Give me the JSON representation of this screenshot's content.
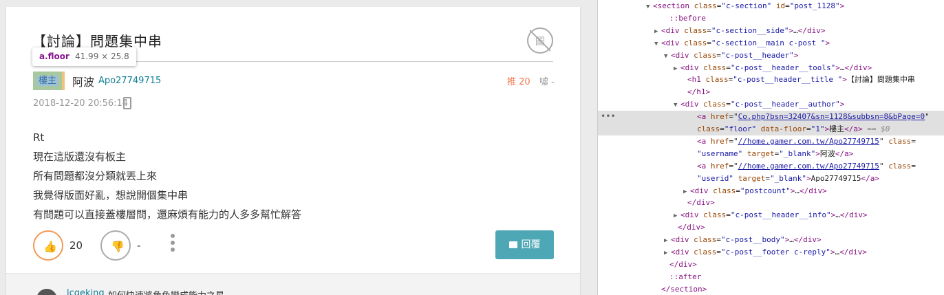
{
  "post": {
    "title": "【討論】問題集中串",
    "noimage_glyph": "圖",
    "tooltip": {
      "tag": "a.floor",
      "size": "41.99 × 25.8"
    },
    "floor_label": "樓主",
    "username": "阿波",
    "userid": "Apo27749715",
    "push": "推 20",
    "boo": "噓 -",
    "date": "2018-12-20 20:56:14",
    "body_lines": [
      "Rt",
      "現在這版還沒有板主",
      "所有問題都沒分類就丟上來",
      "我覺得版面好亂，想說開個集中串",
      "有問題可以直接蓋樓層問，還麻煩有能力的人多多幫忙解答"
    ],
    "gp_count": "20",
    "bp_count": "-",
    "reply_label": "回覆",
    "comment_user": "lcgeking",
    "comment_text": "如何快速將角色變成能力之星"
  },
  "devtools": {
    "lines": [
      {
        "indent": 70,
        "tri": "▼",
        "parts": [
          [
            "tag",
            "<section "
          ],
          [
            "an",
            "class"
          ],
          [
            "",
            "="
          ],
          [
            "av",
            "\"c-section\""
          ],
          [
            "",
            " "
          ],
          [
            "an",
            "id"
          ],
          [
            "",
            "="
          ],
          [
            "av",
            "\"post_1128\""
          ],
          [
            "tag",
            ">"
          ]
        ]
      },
      {
        "indent": 94,
        "tri": "",
        "parts": [
          [
            "pseudo",
            "::before"
          ]
        ]
      },
      {
        "indent": 82,
        "tri": "▶",
        "parts": [
          [
            "tag",
            "<div "
          ],
          [
            "an",
            "class"
          ],
          [
            "",
            "="
          ],
          [
            "av",
            "\"c-section__side\""
          ],
          [
            "tag",
            ">"
          ],
          [
            "",
            "…"
          ],
          [
            "tag",
            "</div>"
          ]
        ]
      },
      {
        "indent": 82,
        "tri": "▼",
        "parts": [
          [
            "tag",
            "<div "
          ],
          [
            "an",
            "class"
          ],
          [
            "",
            "="
          ],
          [
            "av",
            "\"c-section__main c-post \""
          ],
          [
            "tag",
            ">"
          ]
        ]
      },
      {
        "indent": 96,
        "tri": "▼",
        "parts": [
          [
            "tag",
            "<div "
          ],
          [
            "an",
            "class"
          ],
          [
            "",
            "="
          ],
          [
            "av",
            "\"c-post__header\""
          ],
          [
            "tag",
            ">"
          ]
        ]
      },
      {
        "indent": 110,
        "tri": "▶",
        "parts": [
          [
            "tag",
            "<div "
          ],
          [
            "an",
            "class"
          ],
          [
            "",
            "="
          ],
          [
            "av",
            "\"c-post__header__tools\""
          ],
          [
            "tag",
            ">"
          ],
          [
            "",
            "…"
          ],
          [
            "tag",
            "</div>"
          ]
        ]
      },
      {
        "indent": 120,
        "tri": "",
        "parts": [
          [
            "tag",
            "<h1 "
          ],
          [
            "an",
            "class"
          ],
          [
            "",
            "="
          ],
          [
            "av",
            "\"c-post__header__title \""
          ],
          [
            "tag",
            ">"
          ],
          [
            "",
            "【討論】問題集中串"
          ]
        ]
      },
      {
        "indent": 120,
        "tri": "",
        "parts": [
          [
            "tag",
            "</h1>"
          ]
        ]
      },
      {
        "indent": 110,
        "tri": "▼",
        "parts": [
          [
            "tag",
            "<div "
          ],
          [
            "an",
            "class"
          ],
          [
            "",
            "="
          ],
          [
            "av",
            "\"c-post__header__author\""
          ],
          [
            "tag",
            ">"
          ]
        ]
      },
      {
        "indent": 134,
        "tri": "",
        "sel": true,
        "parts": [
          [
            "tag",
            "<a "
          ],
          [
            "an",
            "href"
          ],
          [
            "",
            "=\""
          ],
          [
            "link",
            "Co.php?bsn=32407&sn=1128&subbsn=8&bPage=0"
          ],
          [
            "",
            "\""
          ]
        ]
      },
      {
        "indent": 134,
        "tri": "",
        "sel": true,
        "parts": [
          [
            "an",
            "class"
          ],
          [
            "",
            "="
          ],
          [
            "av",
            "\"floor\""
          ],
          [
            "",
            " "
          ],
          [
            "an",
            "data-floor"
          ],
          [
            "",
            "="
          ],
          [
            "av",
            "\"1\""
          ],
          [
            "tag",
            ">"
          ],
          [
            "",
            "樓主"
          ],
          [
            "tag",
            "</a>"
          ],
          [
            "dim",
            " == $0"
          ]
        ]
      },
      {
        "indent": 134,
        "tri": "",
        "parts": [
          [
            "tag",
            "<a "
          ],
          [
            "an",
            "href"
          ],
          [
            "",
            "=\""
          ],
          [
            "link",
            "//home.gamer.com.tw/Apo27749715"
          ],
          [
            "",
            "\" "
          ],
          [
            "an",
            "class"
          ],
          [
            "",
            "="
          ]
        ]
      },
      {
        "indent": 134,
        "tri": "",
        "parts": [
          [
            "av",
            "\"username\""
          ],
          [
            "",
            " "
          ],
          [
            "an",
            "target"
          ],
          [
            "",
            "="
          ],
          [
            "av",
            "\"_blank\""
          ],
          [
            "tag",
            ">"
          ],
          [
            "",
            "阿波"
          ],
          [
            "tag",
            "</a>"
          ]
        ]
      },
      {
        "indent": 134,
        "tri": "",
        "parts": [
          [
            "tag",
            "<a "
          ],
          [
            "an",
            "href"
          ],
          [
            "",
            "=\""
          ],
          [
            "link",
            "//home.gamer.com.tw/Apo27749715"
          ],
          [
            "",
            "\" "
          ],
          [
            "an",
            "class"
          ],
          [
            "",
            "="
          ]
        ]
      },
      {
        "indent": 134,
        "tri": "",
        "parts": [
          [
            "av",
            "\"userid\""
          ],
          [
            "",
            " "
          ],
          [
            "an",
            "target"
          ],
          [
            "",
            "="
          ],
          [
            "av",
            "\"_blank\""
          ],
          [
            "tag",
            ">"
          ],
          [
            "",
            "Apo27749715"
          ],
          [
            "tag",
            "</a>"
          ]
        ]
      },
      {
        "indent": 124,
        "tri": "▶",
        "parts": [
          [
            "tag",
            "<div "
          ],
          [
            "an",
            "class"
          ],
          [
            "",
            "="
          ],
          [
            "av",
            "\"postcount\""
          ],
          [
            "tag",
            ">"
          ],
          [
            "",
            "…"
          ],
          [
            "tag",
            "</div>"
          ]
        ]
      },
      {
        "indent": 120,
        "tri": "",
        "parts": [
          [
            "tag",
            "</div>"
          ]
        ]
      },
      {
        "indent": 110,
        "tri": "▶",
        "parts": [
          [
            "tag",
            "<div "
          ],
          [
            "an",
            "class"
          ],
          [
            "",
            "="
          ],
          [
            "av",
            "\"c-post__header__info\""
          ],
          [
            "tag",
            ">"
          ],
          [
            "",
            "…"
          ],
          [
            "tag",
            "</div>"
          ]
        ]
      },
      {
        "indent": 106,
        "tri": "",
        "parts": [
          [
            "tag",
            "</div>"
          ]
        ]
      },
      {
        "indent": 96,
        "tri": "▶",
        "parts": [
          [
            "tag",
            "<div "
          ],
          [
            "an",
            "class"
          ],
          [
            "",
            "="
          ],
          [
            "av",
            "\"c-post__body\""
          ],
          [
            "tag",
            ">"
          ],
          [
            "",
            "…"
          ],
          [
            "tag",
            "</div>"
          ]
        ]
      },
      {
        "indent": 96,
        "tri": "▶",
        "parts": [
          [
            "tag",
            "<div "
          ],
          [
            "an",
            "class"
          ],
          [
            "",
            "="
          ],
          [
            "av",
            "\"c-post__footer c-reply\""
          ],
          [
            "tag",
            ">"
          ],
          [
            "",
            "…"
          ],
          [
            "tag",
            "</div>"
          ]
        ]
      },
      {
        "indent": 94,
        "tri": "",
        "parts": [
          [
            "tag",
            "</div>"
          ]
        ]
      },
      {
        "indent": 94,
        "tri": "",
        "parts": [
          [
            "pseudo",
            "::after"
          ]
        ]
      },
      {
        "indent": 82,
        "tri": "",
        "parts": [
          [
            "tag",
            "</section>"
          ]
        ]
      }
    ],
    "gutter_dots": "•••"
  }
}
